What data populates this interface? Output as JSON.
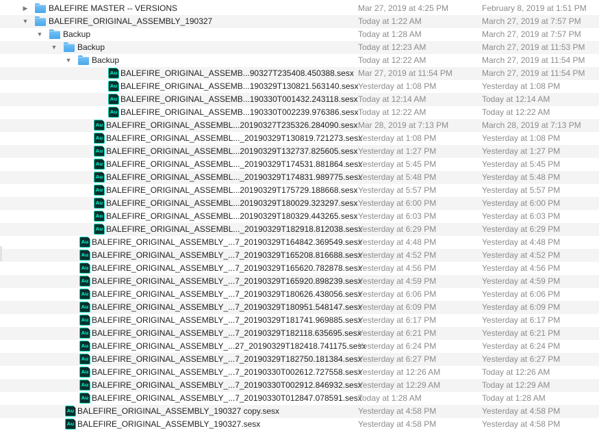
{
  "file_list": {
    "rows": [
      {
        "kind": "folder",
        "depth": 0,
        "disclosure": "collapsed",
        "name": "BALEFIRE MASTER -- VERSIONS",
        "modified": "Mar 27, 2019 at 4:25 PM",
        "created": "February 8, 2019 at 1:51 PM"
      },
      {
        "kind": "folder",
        "depth": 0,
        "disclosure": "expanded",
        "name": "BALEFIRE_ORIGINAL_ASSEMBLY_190327",
        "modified": "Today at 1:22 AM",
        "created": "March 27, 2019 at 7:57 PM"
      },
      {
        "kind": "folder",
        "depth": 1,
        "disclosure": "expanded",
        "name": "Backup",
        "modified": "Today at 1:28 AM",
        "created": "March 27, 2019 at 7:57 PM"
      },
      {
        "kind": "folder",
        "depth": 2,
        "disclosure": "expanded",
        "name": "Backup",
        "modified": "Today at 12:23 AM",
        "created": "March 27, 2019 at 11:53 PM"
      },
      {
        "kind": "folder",
        "depth": 3,
        "disclosure": "expanded",
        "name": "Backup",
        "modified": "Today at 12:22 AM",
        "created": "March 27, 2019 at 11:54 PM"
      },
      {
        "kind": "file",
        "depth": 4,
        "name": "BALEFIRE_ORIGINAL_ASSEMB...90327T235408.450388.sesx",
        "modified": "Mar 27, 2019 at 11:54 PM",
        "created": "March 27, 2019 at 11:54 PM"
      },
      {
        "kind": "file",
        "depth": 4,
        "name": "BALEFIRE_ORIGINAL_ASSEMB...190329T130821.563140.sesx",
        "modified": "Yesterday at 1:08 PM",
        "created": "Yesterday at 1:08 PM"
      },
      {
        "kind": "file",
        "depth": 4,
        "name": "BALEFIRE_ORIGINAL_ASSEMB...190330T001432.243118.sesx",
        "modified": "Today at 12:14 AM",
        "created": "Today at 12:14 AM"
      },
      {
        "kind": "file",
        "depth": 4,
        "name": "BALEFIRE_ORIGINAL_ASSEMB...190330T002239.976386.sesx",
        "modified": "Today at 12:22 AM",
        "created": "Today at 12:22 AM"
      },
      {
        "kind": "file",
        "depth": 3,
        "name": "BALEFIRE_ORIGINAL_ASSEMBL...20190327T235326.284090.sesx",
        "modified": "Mar 28, 2019 at 7:13 PM",
        "created": "March 28, 2019 at 7:13 PM"
      },
      {
        "kind": "file",
        "depth": 3,
        "name": "BALEFIRE_ORIGINAL_ASSEMBL..._20190329T130819.721273.sesx",
        "modified": "Yesterday at 1:08 PM",
        "created": "Yesterday at 1:08 PM"
      },
      {
        "kind": "file",
        "depth": 3,
        "name": "BALEFIRE_ORIGINAL_ASSEMBL...20190329T132737.825605.sesx",
        "modified": "Yesterday at 1:27 PM",
        "created": "Yesterday at 1:27 PM"
      },
      {
        "kind": "file",
        "depth": 3,
        "name": "BALEFIRE_ORIGINAL_ASSEMBL..._20190329T174531.881864.sesx",
        "modified": "Yesterday at 5:45 PM",
        "created": "Yesterday at 5:45 PM"
      },
      {
        "kind": "file",
        "depth": 3,
        "name": "BALEFIRE_ORIGINAL_ASSEMBL..._20190329T174831.989775.sesx",
        "modified": "Yesterday at 5:48 PM",
        "created": "Yesterday at 5:48 PM"
      },
      {
        "kind": "file",
        "depth": 3,
        "name": "BALEFIRE_ORIGINAL_ASSEMBL...20190329T175729.188668.sesx",
        "modified": "Yesterday at 5:57 PM",
        "created": "Yesterday at 5:57 PM"
      },
      {
        "kind": "file",
        "depth": 3,
        "name": "BALEFIRE_ORIGINAL_ASSEMBL...20190329T180029.323297.sesx",
        "modified": "Yesterday at 6:00 PM",
        "created": "Yesterday at 6:00 PM"
      },
      {
        "kind": "file",
        "depth": 3,
        "name": "BALEFIRE_ORIGINAL_ASSEMBL...20190329T180329.443265.sesx",
        "modified": "Yesterday at 6:03 PM",
        "created": "Yesterday at 6:03 PM"
      },
      {
        "kind": "file",
        "depth": 3,
        "name": "BALEFIRE_ORIGINAL_ASSEMBL..._20190329T182918.812038.sesx",
        "modified": "Yesterday at 6:29 PM",
        "created": "Yesterday at 6:29 PM"
      },
      {
        "kind": "file",
        "depth": 2,
        "name": "BALEFIRE_ORIGINAL_ASSEMBLY_...7_20190329T164842.369549.sesx",
        "modified": "Yesterday at 4:48 PM",
        "created": "Yesterday at 4:48 PM"
      },
      {
        "kind": "file",
        "depth": 2,
        "name": "BALEFIRE_ORIGINAL_ASSEMBLY_...7_20190329T165208.816688.sesx",
        "modified": "Yesterday at 4:52 PM",
        "created": "Yesterday at 4:52 PM"
      },
      {
        "kind": "file",
        "depth": 2,
        "name": "BALEFIRE_ORIGINAL_ASSEMBLY_...7_20190329T165620.782878.sesx",
        "modified": "Yesterday at 4:56 PM",
        "created": "Yesterday at 4:56 PM"
      },
      {
        "kind": "file",
        "depth": 2,
        "name": "BALEFIRE_ORIGINAL_ASSEMBLY_...7_20190329T165920.898239.sesx",
        "modified": "Yesterday at 4:59 PM",
        "created": "Yesterday at 4:59 PM"
      },
      {
        "kind": "file",
        "depth": 2,
        "name": "BALEFIRE_ORIGINAL_ASSEMBLY_...7_20190329T180626.438056.sesx",
        "modified": "Yesterday at 6:06 PM",
        "created": "Yesterday at 6:06 PM"
      },
      {
        "kind": "file",
        "depth": 2,
        "name": "BALEFIRE_ORIGINAL_ASSEMBLY_...7_20190329T180951.548147.sesx",
        "modified": "Yesterday at 6:09 PM",
        "created": "Yesterday at 6:09 PM"
      },
      {
        "kind": "file",
        "depth": 2,
        "name": "BALEFIRE_ORIGINAL_ASSEMBLY_...7_20190329T181741.969885.sesx",
        "modified": "Yesterday at 6:17 PM",
        "created": "Yesterday at 6:17 PM"
      },
      {
        "kind": "file",
        "depth": 2,
        "name": "BALEFIRE_ORIGINAL_ASSEMBLY_...7_20190329T182118.635695.sesx",
        "modified": "Yesterday at 6:21 PM",
        "created": "Yesterday at 6:21 PM"
      },
      {
        "kind": "file",
        "depth": 2,
        "name": "BALEFIRE_ORIGINAL_ASSEMBLY_...27_20190329T182418.741175.sesx",
        "modified": "Yesterday at 6:24 PM",
        "created": "Yesterday at 6:24 PM"
      },
      {
        "kind": "file",
        "depth": 2,
        "name": "BALEFIRE_ORIGINAL_ASSEMBLY_...7_20190329T182750.181384.sesx",
        "modified": "Yesterday at 6:27 PM",
        "created": "Yesterday at 6:27 PM"
      },
      {
        "kind": "file",
        "depth": 2,
        "name": "BALEFIRE_ORIGINAL_ASSEMBLY_...7_20190330T002612.727558.sesx",
        "modified": "Yesterday at 12:26 AM",
        "created": "Today at 12:26 AM"
      },
      {
        "kind": "file",
        "depth": 2,
        "name": "BALEFIRE_ORIGINAL_ASSEMBLY_...7_20190330T002912.846932.sesx",
        "modified": "Yesterday at 12:29 AM",
        "created": "Today at 12:29 AM"
      },
      {
        "kind": "file",
        "depth": 2,
        "name": "BALEFIRE_ORIGINAL_ASSEMBLY_...7_20190330T012847.078591.sesx",
        "modified": "Today at 1:28 AM",
        "created": "Today at 1:28 AM"
      },
      {
        "kind": "file",
        "depth": 1,
        "name": "BALEFIRE_ORIGINAL_ASSEMBLY_190327 copy.sesx",
        "modified": "Yesterday at 4:58 PM",
        "created": "Yesterday at 4:58 PM"
      },
      {
        "kind": "file",
        "depth": 1,
        "name": "BALEFIRE_ORIGINAL_ASSEMBLY_190327.sesx",
        "modified": "Yesterday at 4:58 PM",
        "created": "Yesterday at 4:58 PM"
      }
    ],
    "file_icon_glyph": "Au",
    "disclosure_glyphs": {
      "collapsed": "▶",
      "expanded": "▼"
    }
  },
  "colors": {
    "folder": "#5ab2ee",
    "audition_icon_bg": "#0c2f2c",
    "audition_icon_accent": "#00d7b6",
    "row_alternate": "#f4f4f5",
    "date_text": "#8c8c8c"
  }
}
